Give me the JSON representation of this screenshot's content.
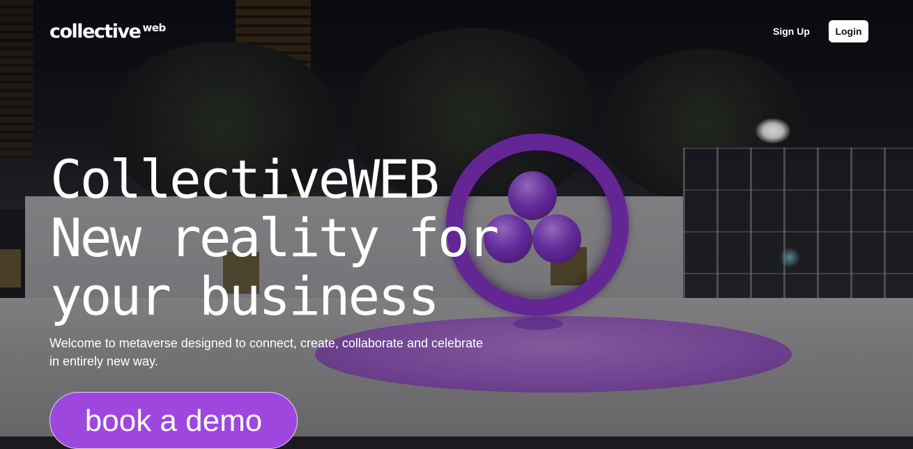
{
  "header": {
    "logo_main": "collective",
    "logo_sub": "web",
    "signup_label": "Sign Up",
    "login_label": "Login"
  },
  "hero": {
    "title_lines": [
      "CollectiveWEB",
      "New reality for",
      "your business"
    ],
    "subtitle": "Welcome to metaverse designed to connect, create, collaborate and celebrate in entirely new way.",
    "cta_label": "book a demo"
  },
  "colors": {
    "accent": "#9d47df",
    "sculpture": "#7a2fb5",
    "text": "#ffffff"
  }
}
